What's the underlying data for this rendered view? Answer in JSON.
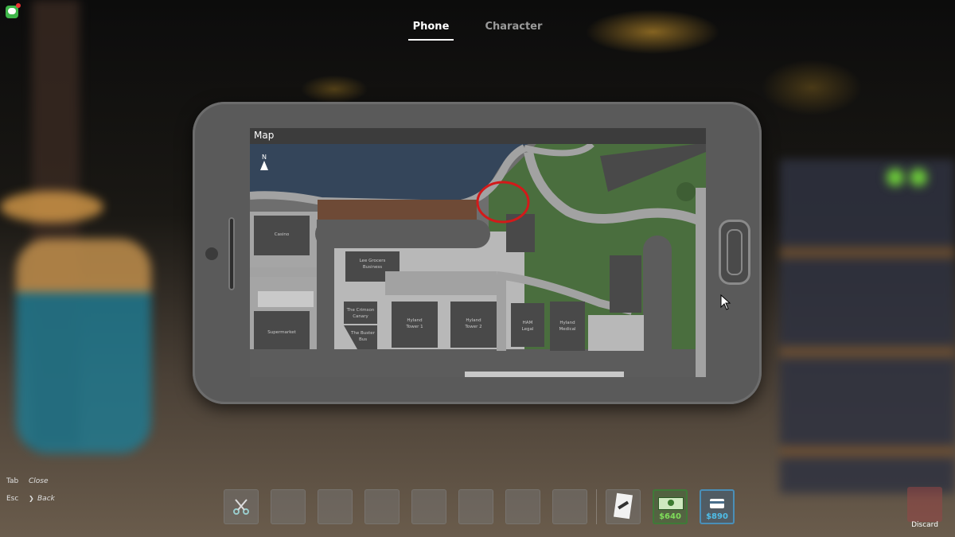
{
  "top_tabs": [
    {
      "label": "Phone",
      "active": true
    },
    {
      "label": "Character",
      "active": false
    }
  ],
  "phone": {
    "app_title": "Map",
    "compass_label": "N",
    "locations": {
      "casino": "Casino",
      "supermarket": "Supermarket",
      "lee_grocers": "Lee Grocers",
      "lee_grocers_2": "Business",
      "crimson_canary": "The Crimson",
      "crimson_canary_2": "Canary",
      "the_buster": "The Buster",
      "the_buster_2": "Bus",
      "hyland_tower_1a": "Hyland",
      "hyland_tower_1b": "Tower 1",
      "hyland_tower_2a": "Hyland",
      "hyland_tower_2b": "Tower 2",
      "ham_legal_a": "HAM",
      "ham_legal_b": "Legal",
      "hyland_medical_a": "Hyland",
      "hyland_medical_b": "Medical"
    }
  },
  "key_hints": [
    {
      "key": "Tab",
      "action": "Close"
    },
    {
      "key": "Esc",
      "action": "Back"
    }
  ],
  "hotbar": {
    "cash_value": "$640",
    "card_value": "$890"
  },
  "discard_label": "Discard",
  "colors": {
    "grass": "#4a6e3e",
    "road": "#a2a2a2",
    "water": "#34455a",
    "building": "#444444",
    "marker": "#d21a1a",
    "cash_accent": "#7fdc5a",
    "card_accent": "#4fbde8"
  },
  "icons": [
    "messages-icon",
    "north-arrow-icon",
    "scissors-icon",
    "paper-icon",
    "cash-icon",
    "card-icon"
  ]
}
